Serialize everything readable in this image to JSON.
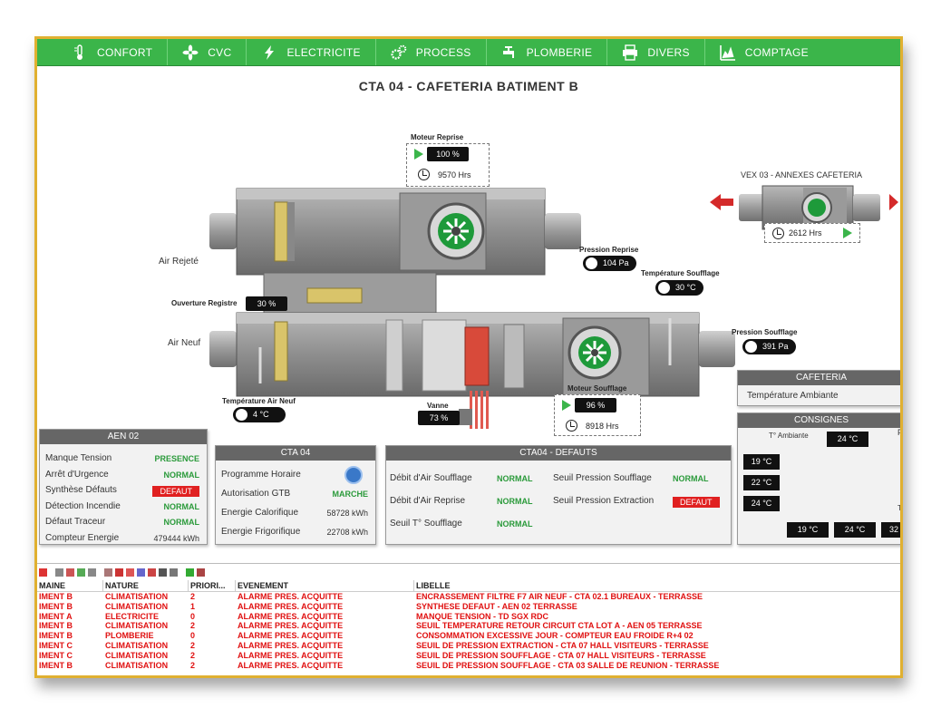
{
  "nav": [
    {
      "label": "CONFORT",
      "icon": "thermometer-icon"
    },
    {
      "label": "CVC",
      "icon": "fan-icon"
    },
    {
      "label": "ELECTRICITE",
      "icon": "lightning-icon"
    },
    {
      "label": "PROCESS",
      "icon": "gears-icon"
    },
    {
      "label": "PLOMBERIE",
      "icon": "faucet-icon"
    },
    {
      "label": "DIVERS",
      "icon": "printer-icon"
    },
    {
      "label": "COMPTAGE",
      "icon": "chart-icon"
    }
  ],
  "page_title": "CTA 04 - CAFETERIA BATIMENT B",
  "synoptic": {
    "air_rejete": "Air Rejeté",
    "air_neuf": "Air Neuf",
    "motor_reprise": {
      "title": "Moteur Reprise",
      "value": "100 %",
      "hours": "9570 Hrs"
    },
    "motor_soufflage": {
      "title": "Moteur Soufflage",
      "value": "96 %",
      "hours": "8918 Hrs"
    },
    "pression_reprise": {
      "title": "Pression Reprise",
      "value": "104 Pa"
    },
    "pression_soufflage": {
      "title": "Pression Soufflage",
      "value": "391 Pa"
    },
    "temp_soufflage": {
      "title": "Température Soufflage",
      "value": "30 °C"
    },
    "temp_air_neuf": {
      "title": "Température Air Neuf",
      "value": "4 °C"
    },
    "ouverture_registre": {
      "title": "Ouverture Registre",
      "value": "30 %"
    },
    "vanne": {
      "title": "Vanne",
      "value": "73 %"
    },
    "vex": {
      "title": "VEX 03 - ANNEXES CAFETERIA",
      "hours": "2612 Hrs"
    }
  },
  "cafeteria": {
    "title": "CAFETERIA",
    "label": "Température Ambiante"
  },
  "consignes": {
    "title": "CONSIGNES",
    "axis_label": "T° Ambiante",
    "top_value": "24 °C",
    "left_values": [
      "19 °C",
      "22 °C",
      "24 °C"
    ],
    "bottom_values": [
      "19 °C",
      "24 °C",
      "32"
    ],
    "right_frag_p": "P",
    "right_frag_t": "T°"
  },
  "aen": {
    "title": "AEN 02",
    "rows": [
      {
        "label": "Manque Tension",
        "status": "PRESENCE",
        "state": "ok"
      },
      {
        "label": "Arrêt d'Urgence",
        "status": "NORMAL",
        "state": "ok"
      },
      {
        "label": "Synthèse Défauts",
        "status": "DEFAUT",
        "state": "def"
      },
      {
        "label": "Détection Incendie",
        "status": "NORMAL",
        "state": "ok"
      },
      {
        "label": "Défaut Traceur",
        "status": "NORMAL",
        "state": "ok"
      },
      {
        "label": "Compteur Energie",
        "status": "479444 kWh",
        "state": "num"
      }
    ]
  },
  "cta": {
    "title": "CTA 04",
    "rows": [
      {
        "label": "Programme Horaire",
        "status": "",
        "state": "clock"
      },
      {
        "label": "Autorisation GTB",
        "status": "MARCHE",
        "state": "ok"
      },
      {
        "label": "Energie Calorifique",
        "status": "58728 kWh",
        "state": "num"
      },
      {
        "label": "Energie Frigorifique",
        "status": "22708 kWh",
        "state": "num"
      }
    ]
  },
  "defauts": {
    "title": "CTA04 - DEFAUTS",
    "left": [
      {
        "label": "Débit d'Air Soufflage",
        "status": "NORMAL",
        "state": "ok"
      },
      {
        "label": "Débit d'Air Reprise",
        "status": "NORMAL",
        "state": "ok"
      },
      {
        "label": "Seuil T° Soufflage",
        "status": "NORMAL",
        "state": "ok"
      }
    ],
    "right": [
      {
        "label": "Seuil Pression Soufflage",
        "status": "NORMAL",
        "state": "ok"
      },
      {
        "label": "Seuil Pression Extraction",
        "status": "DEFAUT",
        "state": "def"
      }
    ]
  },
  "alarms": {
    "headers": [
      "MAINE",
      "NATURE",
      "PRIORI...",
      "EVENEMENT",
      "LIBELLE"
    ],
    "rows": [
      [
        "IMENT B",
        "CLIMATISATION",
        "2",
        "ALARME PRES. ACQUITTE",
        "ENCRASSEMENT FILTRE F7 AIR NEUF - CTA 02.1 BUREAUX - TERRASSE"
      ],
      [
        "IMENT B",
        "CLIMATISATION",
        "1",
        "ALARME PRES. ACQUITTE",
        "SYNTHESE DEFAUT - AEN 02 TERRASSE"
      ],
      [
        "IMENT A",
        "ELECTRICITE",
        "0",
        "ALARME PRES. ACQUITTE",
        "MANQUE TENSION - TD SGX RDC"
      ],
      [
        "IMENT B",
        "CLIMATISATION",
        "2",
        "ALARME PRES. ACQUITTE",
        "SEUIL TEMPERATURE RETOUR CIRCUIT CTA LOT A - AEN 05 TERRASSE"
      ],
      [
        "IMENT B",
        "PLOMBERIE",
        "0",
        "ALARME PRES. ACQUITTE",
        "CONSOMMATION EXCESSIVE JOUR - COMPTEUR EAU FROIDE R+4 02"
      ],
      [
        "IMENT C",
        "CLIMATISATION",
        "2",
        "ALARME PRES. ACQUITTE",
        "SEUIL DE PRESSION EXTRACTION - CTA 07 HALL VISITEURS - TERRASSE"
      ],
      [
        "IMENT C",
        "CLIMATISATION",
        "2",
        "ALARME PRES. ACQUITTE",
        "SEUIL DE PRESSION SOUFFLAGE - CTA 07 HALL VISITEURS - TERRASSE"
      ],
      [
        "IMENT B",
        "CLIMATISATION",
        "2",
        "ALARME PRES. ACQUITTE",
        "SEUIL DE PRESSION SOUFFLAGE - CTA 03 SALLE DE REUNION - TERRASSE"
      ]
    ]
  },
  "colors": {
    "nav_green": "#3bb54a",
    "defaut_red": "#e02020",
    "normal_green": "#2a9a3a",
    "alarm_red": "#e01010"
  }
}
